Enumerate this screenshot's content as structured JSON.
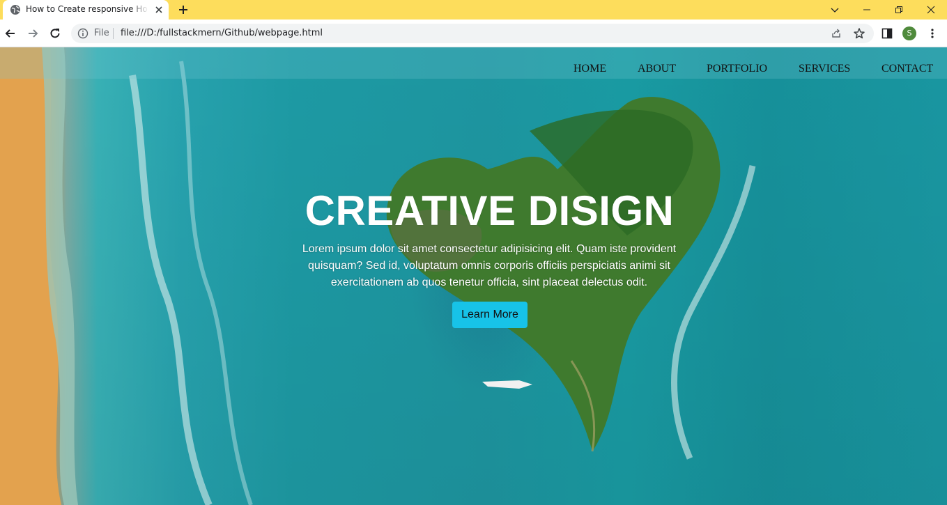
{
  "browser": {
    "tab_title": "How to Create responsive Homepage",
    "scheme_label": "File",
    "url": "file:///D:/fullstackmern/Github/webpage.html",
    "profile_initial": "S",
    "icons": [
      "globe-icon",
      "close-icon",
      "plus-icon",
      "chevron-down-icon",
      "minimize-icon",
      "restore-icon",
      "window-close-icon",
      "back-arrow-icon",
      "forward-arrow-icon",
      "reload-icon",
      "info-icon",
      "share-icon",
      "star-icon",
      "side-panel-icon",
      "kebab-menu-icon"
    ],
    "colors": {
      "tab_strip": "#fddd5c",
      "avatar": "#4f8a3c"
    }
  },
  "page": {
    "nav": [
      "HOME",
      "ABOUT",
      "PORTFOLIO",
      "SERVICES",
      "CONTACT"
    ],
    "hero": {
      "title": "CREATIVE DISIGN",
      "text": "Lorem ipsum dolor sit amet consectetur adipisicing elit. Quam iste provident quisquam? Sed id, voluptatum omnis corporis officiis perspiciatis animi sit exercitationem ab quos tenetur officia, sint placeat delectus odit.",
      "button": "Learn More"
    },
    "colors": {
      "button": "#17c3e8",
      "ocean": "#1e9fa9",
      "sand": "#e2a64f"
    }
  }
}
